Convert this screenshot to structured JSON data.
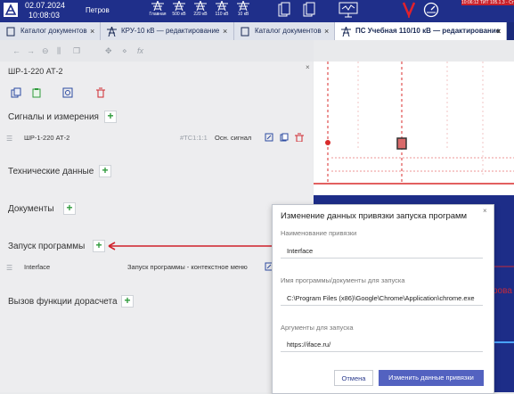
{
  "header": {
    "date": "02.07.2024",
    "time": "10:08:03",
    "user": "Петров",
    "nav": [
      {
        "label": "Главная",
        "icon": "tower-icon"
      },
      {
        "label": "500 кВ",
        "icon": "tower-icon"
      },
      {
        "label": "220 кВ",
        "icon": "tower-icon"
      },
      {
        "label": "110 кВ",
        "icon": "tower-icon"
      },
      {
        "label": "10 кВ",
        "icon": "tower-icon"
      }
    ],
    "status_text": "10:06:12  ТИТ 105.1.3 - Ст",
    "colors": {
      "topbar": "#1f2f8a",
      "alert": "#c9202a"
    }
  },
  "tabs": [
    {
      "label": "Каталог документов",
      "close": "×"
    },
    {
      "label": "КРУ-10 кВ — редактирование",
      "close": "×"
    },
    {
      "label": "Каталог документов",
      "close": "×"
    },
    {
      "label": "ПС Учебная 110/10 кВ — редактирование",
      "close": "×"
    }
  ],
  "toolbar": {
    "fx": "fx"
  },
  "panel": {
    "title": "ШР-1-220 АТ-2",
    "close": "×",
    "sections": {
      "signals": "Сигналы и измерения",
      "tech": "Технические данные",
      "docs": "Документы",
      "launch": "Запуск программы",
      "calc": "Вызов функции дорасчета"
    },
    "signal_row": {
      "name": "ШР-1-220 АТ-2",
      "tag": "#ТС1:1:1",
      "type": "Осн. сигнал"
    },
    "launch_row": {
      "name": "Interface",
      "type": "Запуск программы - контекстное меню"
    },
    "plus": "+"
  },
  "dialog": {
    "title": "Изменение данных привязки запуска программ",
    "close": "×",
    "name_label": "Наименование привязки",
    "name_value": "Interface",
    "path_label": "Имя программы/документы для запуска",
    "path_value": "C:\\Program Files (x86)\\Google\\Chrome\\Application\\chrome.exe",
    "args_label": "Аргументы для запуска",
    "args_value": "https://iface.ru/",
    "cancel": "Отмена",
    "submit": "Изменить данные привязки"
  },
  "canvas": {
    "partial_text": "рова"
  }
}
